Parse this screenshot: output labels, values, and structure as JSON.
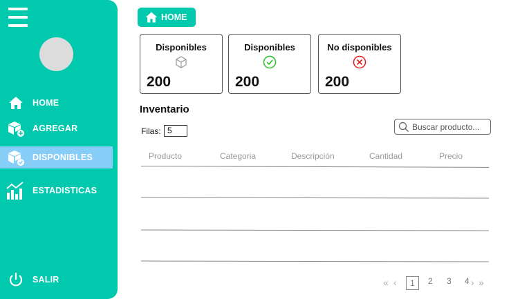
{
  "sidebar": {
    "items": [
      {
        "label": "HOME",
        "icon": "home-icon"
      },
      {
        "label": "AGREGAR",
        "icon": "add-box-icon"
      },
      {
        "label": "DISPONIBLES",
        "icon": "available-box-icon"
      },
      {
        "label": "ESTADISTICAS",
        "icon": "stats-chart-icon"
      }
    ],
    "logout_label": "SALIR",
    "active_item": "DISPONIBLES",
    "active_color": "#86cdf7",
    "bg_color": "#00c9ae"
  },
  "breadcrumb": {
    "label": "HOME",
    "icon": "home-icon"
  },
  "cards": [
    {
      "title": "Disponibles",
      "value": "200",
      "icon": "box-icon"
    },
    {
      "title": "Disponibles",
      "value": "200",
      "icon": "check-circle-icon",
      "icon_color": "#22c022"
    },
    {
      "title": "No disponibles",
      "value": "200",
      "icon": "x-circle-icon",
      "icon_color": "#e01b1b"
    }
  ],
  "inventory": {
    "title": "Inventario",
    "rows_label": "Filas:",
    "rows_value": "5",
    "search_placeholder": "Buscar producto...",
    "columns": [
      "Producto",
      "Categoria",
      "Descripción",
      "Cantidad",
      "Precio"
    ]
  },
  "pagination": {
    "pages": [
      "1",
      "2",
      "3",
      "4"
    ],
    "current": "1"
  }
}
